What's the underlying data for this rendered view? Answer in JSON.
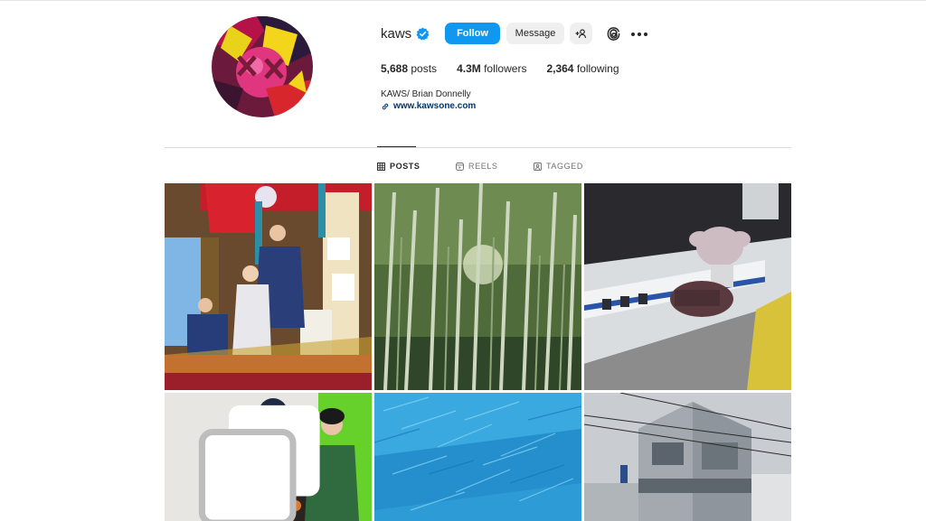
{
  "profile": {
    "username": "kaws",
    "verified": true,
    "follow_label": "Follow",
    "message_label": "Message",
    "posts_count": "5,688",
    "posts_label": "posts",
    "followers_count": "4.3M",
    "followers_label": "followers",
    "following_count": "2,364",
    "following_label": "following",
    "full_name": "KAWS/ Brian Donnelly",
    "website": "www.kawsone.com"
  },
  "tabs": [
    {
      "label": "POSTS",
      "icon": "grid-icon",
      "active": true
    },
    {
      "label": "REELS",
      "icon": "reels-icon",
      "active": false
    },
    {
      "label": "TAGGED",
      "icon": "tagged-icon",
      "active": false
    }
  ],
  "posts": [
    {
      "subject": "festival-float",
      "multi": false
    },
    {
      "subject": "bamboo-forest",
      "multi": false
    },
    {
      "subject": "companion-train-station",
      "multi": false
    },
    {
      "subject": "gallery-portrait",
      "multi": true
    },
    {
      "subject": "blue-abstract",
      "multi": false
    },
    {
      "subject": "building-facade",
      "multi": false
    }
  ],
  "colors": {
    "accent": "#1098f0",
    "link": "#00376b",
    "text": "#262626",
    "muted": "#737373",
    "divider": "#dbdbdb"
  }
}
